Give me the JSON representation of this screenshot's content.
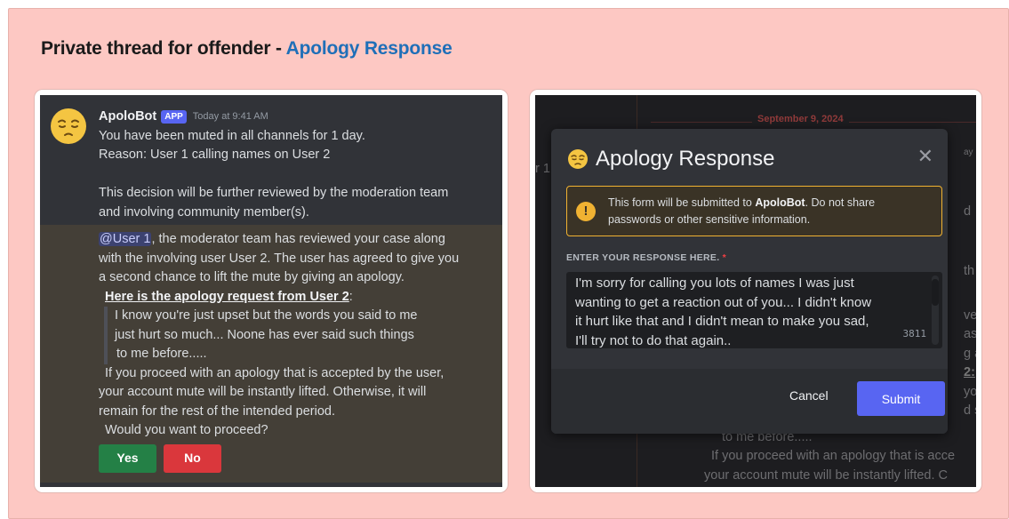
{
  "heading": {
    "prefix": "Private thread for offender - ",
    "accent": "Apology Response"
  },
  "left": {
    "bot_name": "ApoloBot",
    "app_tag": "APP",
    "timestamp": "Today at 9:41 AM",
    "lines": [
      "You have been muted in all channels for 1 day.",
      "Reason: User 1 calling names on User 2",
      "This decision will be further reviewed by the moderation team",
      "and involving community member(s)."
    ],
    "mention": "@User 1",
    "mention_rest": ", the moderator team has reviewed your case along",
    "body_lines": [
      "with the involving user User 2. The user has agreed to give you",
      "a second chance to lift the mute by giving an apology."
    ],
    "request_title": "Here is the apology request from User 2",
    "request_colon": ":",
    "quote_lines": [
      "I know you're just upset but the words you said to me",
      "just hurt so much... Noone has ever said such things",
      "to me before....."
    ],
    "tail_lines": [
      "If you proceed with an apology that is accepted by the user,",
      "your account mute will be instantly lifted. Otherwise, it will",
      "remain for the rest of the intended period.",
      "Would you want to proceed?"
    ],
    "yes_label": "Yes",
    "no_label": "No"
  },
  "right": {
    "bg_date": "September 9, 2024",
    "bg_fragments": [
      "r 1",
      "ay",
      "d",
      "th",
      "ve",
      "as",
      "g a",
      "2:",
      "yo",
      "d s"
    ],
    "bg_lines": [
      "to me before.....",
      "If you proceed with an apology that is acce",
      "your account mute will be instantly lifted. C"
    ],
    "modal": {
      "title": "Apology Response",
      "close_label": "✕",
      "notice_pre": "This form will be submitted to ",
      "notice_bold": "ApoloBot",
      "notice_post": ". Do not share",
      "notice_line2": "passwords or other sensitive information.",
      "notice_icon": "!",
      "field_label": "ENTER YOUR RESPONSE HERE.",
      "field_required": "*",
      "response_lines": [
        "I'm sorry for calling you lots of names I was just",
        "wanting to get a reaction out of you... I didn't know",
        "it hurt like that and I didn't mean to make you sad,",
        "I'll try not to do that again.."
      ],
      "char_counter": "3811",
      "cancel_label": "Cancel",
      "submit_label": "Submit"
    }
  },
  "colors": {
    "page_bg": "#fdc8c3",
    "accent": "#1f6fb8",
    "blurple": "#5865f2",
    "yes": "#248046",
    "no": "#da373c",
    "warning": "#f0b232"
  },
  "icons": {
    "avatar": "pensive-face-icon",
    "modal_title": "pensive-face-icon",
    "close": "close-icon",
    "notice": "warning-icon"
  }
}
